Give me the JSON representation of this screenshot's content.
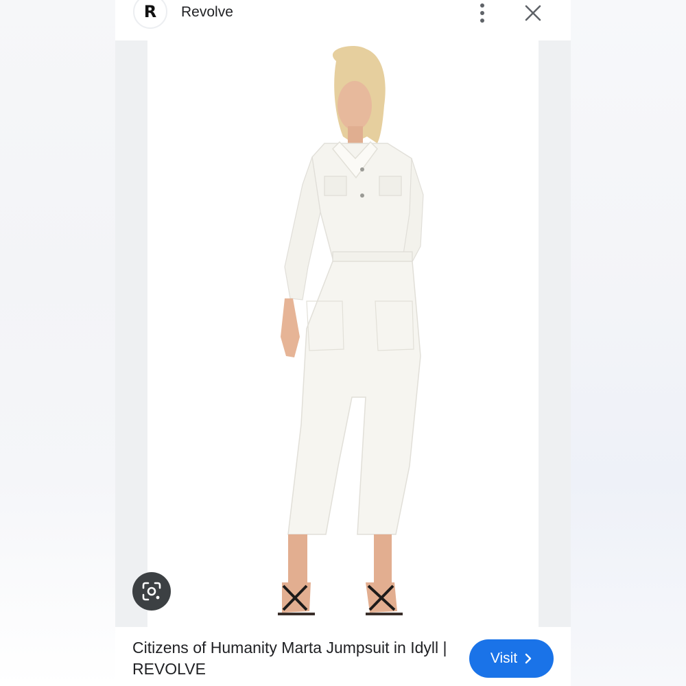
{
  "header": {
    "avatar_letter": "R",
    "site_name": "Revolve"
  },
  "image": {
    "alt": "Citizens of Humanity Marta Jumpsuit in Idyll | REVOLVE"
  },
  "caption": {
    "title": "Citizens of Humanity Marta Jumpsuit in Idyll | REVOLVE"
  },
  "actions": {
    "visit_label": "Visit"
  },
  "icons": {
    "more": "more-vert-icon",
    "close": "close-icon",
    "lens": "google-lens-icon",
    "visit_chevron": "chevron-right-icon"
  },
  "colors": {
    "accent": "#1a73e8",
    "lens_button": "#3c4043",
    "text": "#202124"
  }
}
